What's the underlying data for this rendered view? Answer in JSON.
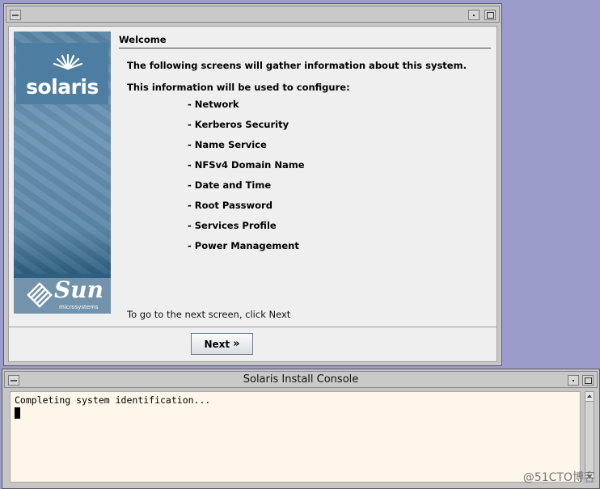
{
  "installer": {
    "heading": "Welcome",
    "intro": "The following screens will gather information about this system.",
    "configure_intro": "This information will be used to configure:",
    "items": [
      {
        "label": "- Network"
      },
      {
        "label": "- Kerberos Security"
      },
      {
        "label": "- Name Service"
      },
      {
        "label": "- NFSv4 Domain Name"
      },
      {
        "label": "- Date and Time"
      },
      {
        "label": "- Root Password"
      },
      {
        "label": "- Services Profile"
      },
      {
        "label": "- Power Management"
      }
    ],
    "footer": "To go to the next screen, click Next",
    "next_label": "Next",
    "next_icon": "chevron-double-right-icon",
    "solaris_logo": "solaris",
    "sun_logo": "Sun",
    "sun_subtext": "microsystems"
  },
  "console": {
    "title": "Solaris Install Console",
    "text": "Completing system identification..."
  },
  "watermark": "@51CTO博客",
  "colors": {
    "desktop": "#9c9ccc",
    "window": "#c6c6c6",
    "panel": "#efefef",
    "console_bg": "#fdf6e9",
    "sidebar_blue": "#5a86a8"
  }
}
